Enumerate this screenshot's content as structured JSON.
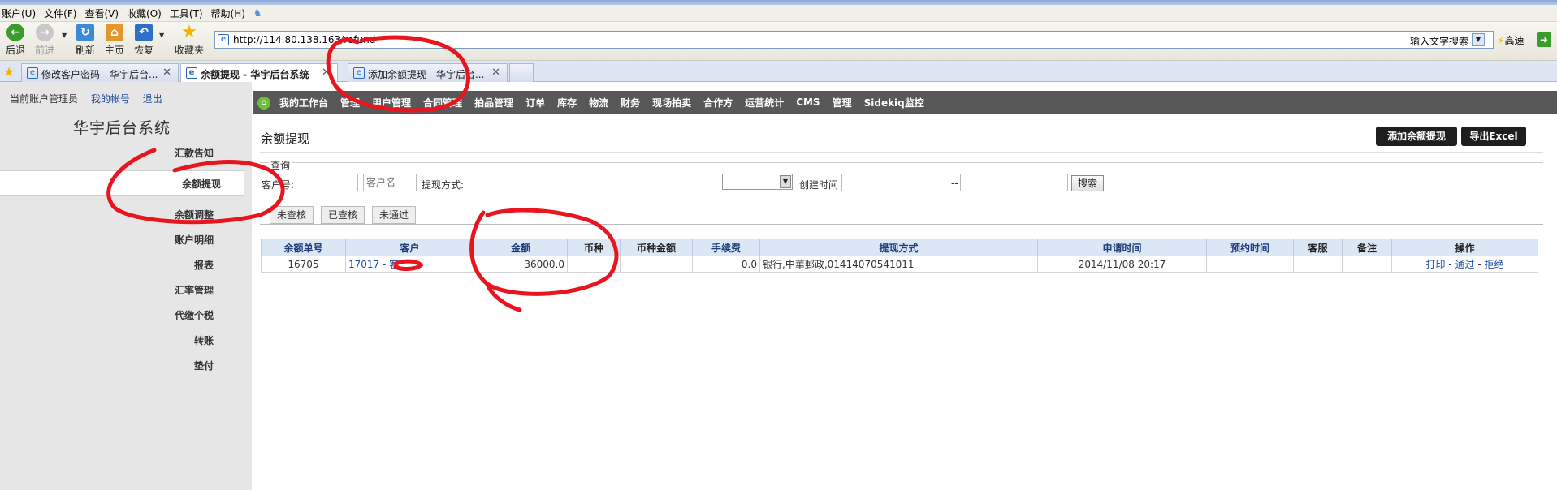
{
  "browser": {
    "menu": [
      "账户(U)",
      "文件(F)",
      "查看(V)",
      "收藏(O)",
      "工具(T)",
      "帮助(H)"
    ],
    "toolbar": {
      "back": "后退",
      "forward": "前进",
      "refresh": "刷新",
      "home": "主页",
      "restore": "恢复",
      "favorites": "收藏夹"
    },
    "address_url": "http://114.80.138.163/refund",
    "search_placeholder": "输入文字搜索",
    "speed_label": "高速",
    "tabs": [
      {
        "label": "修改客户密码 - 华宇后台..."
      },
      {
        "label": "余额提现 - 华宇后台系统"
      },
      {
        "label": "添加余额提现 - 华宇后台..."
      }
    ]
  },
  "sidebar": {
    "current_user_label": "当前账户管理员",
    "my_account": "我的帐号",
    "logout": "退出",
    "system_title": "华宇后台系统",
    "items": [
      "汇款告知",
      "余额提现",
      "余额调整",
      "账户明细",
      "报表",
      "汇率管理",
      "代缴个税",
      "转账",
      "垫付"
    ]
  },
  "mainnav": {
    "items": [
      "我的工作台",
      "管理",
      "用户管理",
      "合同管理",
      "拍品管理",
      "订单",
      "库存",
      "物流",
      "财务",
      "现场拍卖",
      "合作方",
      "运营统计",
      "CMS",
      "管理",
      "Sidekiq监控"
    ]
  },
  "page": {
    "title": "余额提现",
    "add_button": "添加余额提现",
    "export_button": "导出Excel",
    "query_legend": "查询",
    "query": {
      "customer_no_label": "客户号:",
      "customer_name_placeholder": "客户名",
      "method_label": "提现方式:",
      "created_label": "创建时间",
      "range_sep": "--",
      "search_button": "搜索"
    },
    "subtabs": [
      "未查核",
      "已查核",
      "未通过"
    ]
  },
  "table": {
    "headers": [
      "余额单号",
      "客户",
      "金额",
      "币种",
      "币种金额",
      "手续费",
      "提现方式",
      "申请时间",
      "预约时间",
      "客服",
      "备注",
      "操作"
    ],
    "rows": [
      {
        "id": "16705",
        "customer": "17017 - 客",
        "amount": "36000.0",
        "currency": "",
        "currency_amount": "",
        "fee": "0.0",
        "method": "银行,中華郵政,01414070541011",
        "applied": "2014/11/08 20:17",
        "reserved": "",
        "service": "",
        "remark": "",
        "actions": {
          "print": "打印",
          "approve": "通过",
          "reject": "拒绝",
          "sep": " - "
        }
      }
    ]
  },
  "colors": {
    "nav_bg": "#585858",
    "sidebar_bg": "#e6e6e6",
    "table_header_bg": "#dce7f6",
    "annotation": "#e8141e"
  }
}
